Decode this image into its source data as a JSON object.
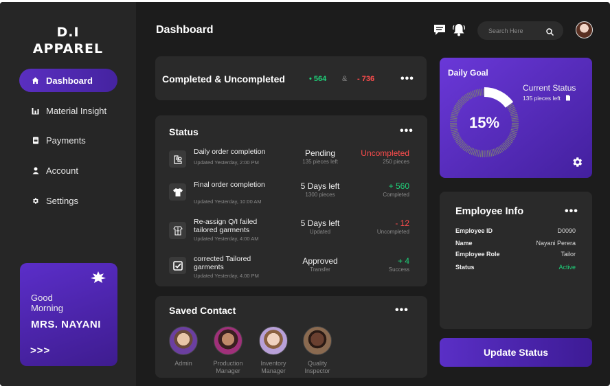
{
  "brand": {
    "line1": "D.I",
    "line2": "APPAREL"
  },
  "sidebar": {
    "items": [
      {
        "label": "Dashboard",
        "icon": "home-icon",
        "active": true
      },
      {
        "label": "Material Insight",
        "icon": "bar-chart-icon",
        "active": false
      },
      {
        "label": "Payments",
        "icon": "document-icon",
        "active": false
      },
      {
        "label": "Account",
        "icon": "user-icon",
        "active": false
      },
      {
        "label": "Settings",
        "icon": "gear-icon",
        "active": false
      }
    ]
  },
  "greeting": {
    "line1": "Good",
    "line2": "Morning",
    "name": "MRS. NAYANI",
    "arrows": ">>>"
  },
  "header": {
    "title": "Dashboard",
    "search_placeholder": "Search Here"
  },
  "completed": {
    "title": "Completed & Uncompleted",
    "completed_value": "• 564",
    "separator": "&",
    "uncompleted_value": "- 736"
  },
  "status": {
    "title": "Status",
    "rows": [
      {
        "title": "Daily order completion",
        "updated": "Updated Yesterday, 2:00 PM",
        "mid_value": "Pending",
        "mid_sub": "135 pieces left",
        "right_value": "Uncompleted",
        "right_sub": "250 pieces",
        "icon": "sewing-icon"
      },
      {
        "title": "Final order completion",
        "updated": "Updated Yesterday, 10:00 AM",
        "mid_value": "5 Days left",
        "mid_sub": "1300 pieces",
        "right_value": "+ 560",
        "right_sub": "Completed",
        "icon": "shirt-icon"
      },
      {
        "title": "Re-assign Q/I failed tailored garments",
        "updated": "Updated Yesterday, 4:00 AM",
        "mid_value": "5 Days left",
        "mid_sub": "Updated",
        "right_value": "- 12",
        "right_sub": "Uncompleted",
        "icon": "garment-icon"
      },
      {
        "title": "corrected Tailored garments",
        "updated": "Updated Yesterday, 4.00 PM",
        "mid_value": "Approved",
        "mid_sub": "Transfer",
        "right_value": "+ 4",
        "right_sub": "Success",
        "icon": "checkbox-icon"
      }
    ]
  },
  "contacts": {
    "title": "Saved Contact",
    "items": [
      {
        "label1": "Admin",
        "label2": ""
      },
      {
        "label1": "Production",
        "label2": "Manager"
      },
      {
        "label1": "Inventory",
        "label2": "Manager"
      },
      {
        "label1": "Quality",
        "label2": "Inspector"
      }
    ]
  },
  "daily_goal": {
    "title": "Daily Goal",
    "percent_label": "15%",
    "progress": 0.15,
    "status_title": "Current Status",
    "status_sub": "135 pieces left"
  },
  "employee": {
    "title": "Employee Info",
    "rows": [
      {
        "key": "Employee ID",
        "value": "D0090"
      },
      {
        "key": "Name",
        "value": "Nayani Perera"
      },
      {
        "key": "Employee Role",
        "value": "Tailor"
      },
      {
        "key": "Status",
        "value": "Active"
      }
    ]
  },
  "update_button": "Update Status",
  "colors": {
    "accent": "#5a2fc6",
    "green": "#1fd27a",
    "red": "#ff4d4d",
    "background": "#1c1c1c",
    "card": "#2a2a2a"
  }
}
